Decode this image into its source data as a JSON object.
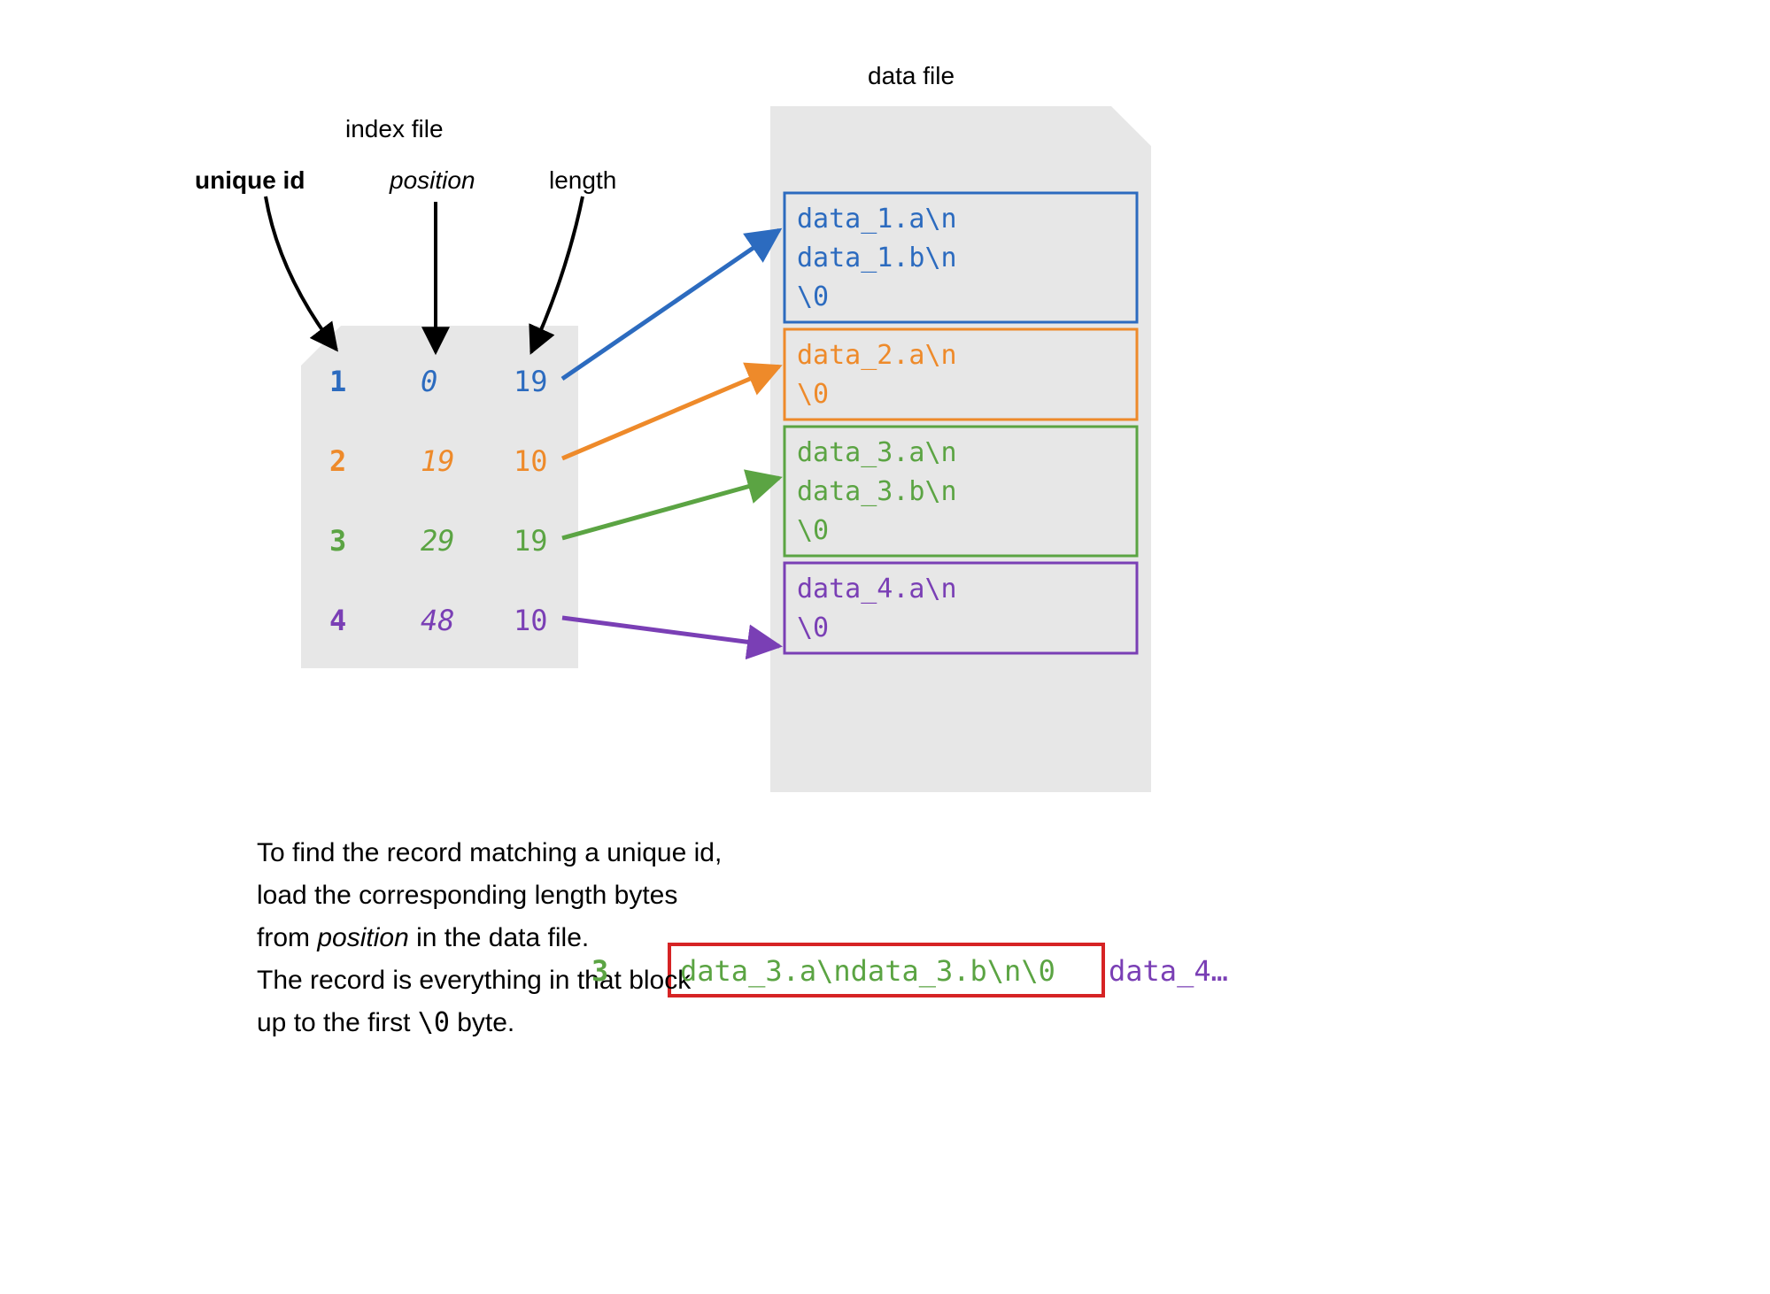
{
  "colors": {
    "c1": "#2C6BBF",
    "c2": "#EE8A2A",
    "c3": "#5BA443",
    "c4": "#7A3FB5",
    "red": "#D62324",
    "cardBg": "#E7E7E7"
  },
  "labels": {
    "indexFile": "index file",
    "dataFile": "data file",
    "header": {
      "id": "unique id",
      "pos": "position",
      "len": "length"
    },
    "explain": {
      "line1": "To find the record matching a unique id,",
      "line2_a": "load the corresponding ",
      "line2_b": "length",
      "line2_c": " bytes",
      "line3_a": "from ",
      "line3_b": "position",
      "line3_c": " in the data file.",
      "line4": "The record is everything in that block",
      "line5_a": "up to the first ",
      "line5_b": "\\0",
      "line5_c": " byte."
    }
  },
  "index_rows": [
    {
      "id": "1",
      "pos": "0",
      "len": "19",
      "color": "c1"
    },
    {
      "id": "2",
      "pos": "19",
      "len": "10",
      "color": "c2"
    },
    {
      "id": "3",
      "pos": "29",
      "len": "19",
      "color": "c3"
    },
    {
      "id": "4",
      "pos": "48",
      "len": "10",
      "color": "c4"
    }
  ],
  "data_records": [
    {
      "lines": [
        "data_1.a\\n",
        "data_1.b\\n",
        "\\0"
      ],
      "color": "c1"
    },
    {
      "lines": [
        "data_2.a\\n",
        "\\0"
      ],
      "color": "c2"
    },
    {
      "lines": [
        "data_3.a\\n",
        "data_3.b\\n",
        "\\0"
      ],
      "color": "c3"
    },
    {
      "lines": [
        "data_4.a\\n",
        "\\0"
      ],
      "color": "c4"
    }
  ],
  "example_lookup": {
    "id": "3",
    "hit": "data_3.a\\ndata_3.b\\n\\0",
    "tail": "data_4…",
    "hit_color": "c3",
    "tail_color": "c4"
  }
}
